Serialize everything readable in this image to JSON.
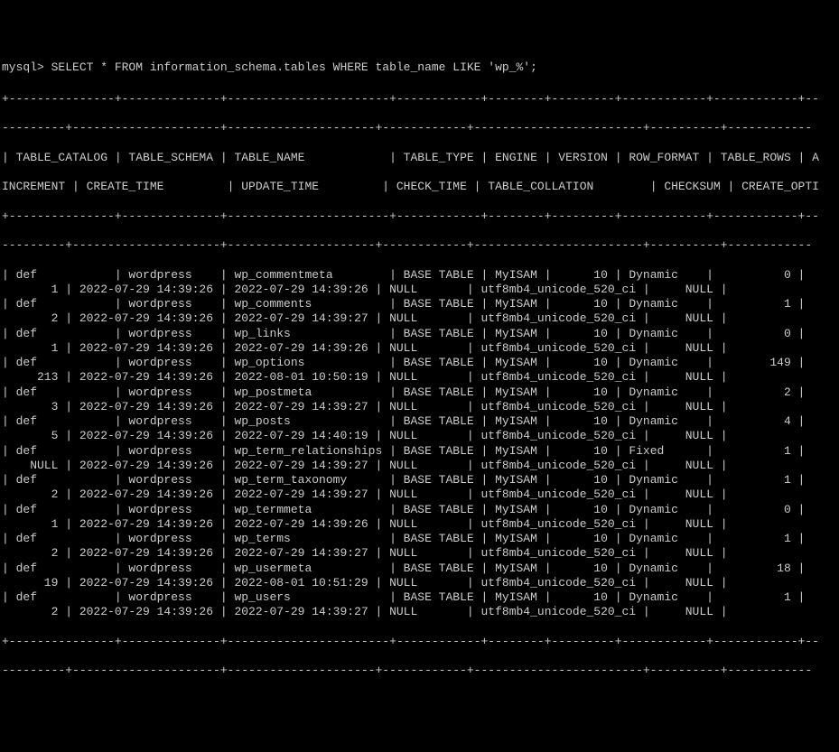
{
  "prompt": "mysql> SELECT * FROM information_schema.tables WHERE table_name LIKE 'wp_%';",
  "hdr1": "| TABLE_CATALOG | TABLE_SCHEMA | TABLE_NAME            | TABLE_TYPE | ENGINE | VERSION | ROW_FORMAT | TABLE_ROWS | A",
  "hdr2": "INCREMENT | CREATE_TIME         | UPDATE_TIME         | CHECK_TIME | TABLE_COLLATION        | CHECKSUM | CREATE_OPTI",
  "sep": "+---------------+--------------+-----------------------+------------+--------+---------+------------+------------+--",
  "sep2": "---------+---------------------+---------------------+------------+------------------------+----------+------------",
  "rows": [
    {
      "a": "| def           | wordpress    | wp_commentmeta        | BASE TABLE | MyISAM |      10 | Dynamic    |          0 |  ",
      "b": "       1 | 2022-07-29 14:39:26 | 2022-07-29 14:39:26 | NULL       | utf8mb4_unicode_520_ci |     NULL |            "
    },
    {
      "a": "| def           | wordpress    | wp_comments           | BASE TABLE | MyISAM |      10 | Dynamic    |          1 |  ",
      "b": "       2 | 2022-07-29 14:39:26 | 2022-07-29 14:39:27 | NULL       | utf8mb4_unicode_520_ci |     NULL |            "
    },
    {
      "a": "| def           | wordpress    | wp_links              | BASE TABLE | MyISAM |      10 | Dynamic    |          0 |  ",
      "b": "       1 | 2022-07-29 14:39:26 | 2022-07-29 14:39:26 | NULL       | utf8mb4_unicode_520_ci |     NULL |            "
    },
    {
      "a": "| def           | wordpress    | wp_options            | BASE TABLE | MyISAM |      10 | Dynamic    |        149 |  ",
      "b": "     213 | 2022-07-29 14:39:26 | 2022-08-01 10:50:19 | NULL       | utf8mb4_unicode_520_ci |     NULL |            "
    },
    {
      "a": "| def           | wordpress    | wp_postmeta           | BASE TABLE | MyISAM |      10 | Dynamic    |          2 |  ",
      "b": "       3 | 2022-07-29 14:39:26 | 2022-07-29 14:39:27 | NULL       | utf8mb4_unicode_520_ci |     NULL |            "
    },
    {
      "a": "| def           | wordpress    | wp_posts              | BASE TABLE | MyISAM |      10 | Dynamic    |          4 |  ",
      "b": "       5 | 2022-07-29 14:39:26 | 2022-07-29 14:40:19 | NULL       | utf8mb4_unicode_520_ci |     NULL |            "
    },
    {
      "a": "| def           | wordpress    | wp_term_relationships | BASE TABLE | MyISAM |      10 | Fixed      |          1 |  ",
      "b": "    NULL | 2022-07-29 14:39:26 | 2022-07-29 14:39:27 | NULL       | utf8mb4_unicode_520_ci |     NULL |            "
    },
    {
      "a": "| def           | wordpress    | wp_term_taxonomy      | BASE TABLE | MyISAM |      10 | Dynamic    |          1 |  ",
      "b": "       2 | 2022-07-29 14:39:26 | 2022-07-29 14:39:27 | NULL       | utf8mb4_unicode_520_ci |     NULL |            "
    },
    {
      "a": "| def           | wordpress    | wp_termmeta           | BASE TABLE | MyISAM |      10 | Dynamic    |          0 |  ",
      "b": "       1 | 2022-07-29 14:39:26 | 2022-07-29 14:39:26 | NULL       | utf8mb4_unicode_520_ci |     NULL |            "
    },
    {
      "a": "| def           | wordpress    | wp_terms              | BASE TABLE | MyISAM |      10 | Dynamic    |          1 |  ",
      "b": "       2 | 2022-07-29 14:39:26 | 2022-07-29 14:39:27 | NULL       | utf8mb4_unicode_520_ci |     NULL |            "
    },
    {
      "a": "| def           | wordpress    | wp_usermeta           | BASE TABLE | MyISAM |      10 | Dynamic    |         18 |  ",
      "b": "      19 | 2022-07-29 14:39:26 | 2022-08-01 10:51:29 | NULL       | utf8mb4_unicode_520_ci |     NULL |            "
    },
    {
      "a": "| def           | wordpress    | wp_users              | BASE TABLE | MyISAM |      10 | Dynamic    |          1 |  ",
      "b": "       2 | 2022-07-29 14:39:26 | 2022-07-29 14:39:27 | NULL       | utf8mb4_unicode_520_ci |     NULL |            "
    }
  ]
}
